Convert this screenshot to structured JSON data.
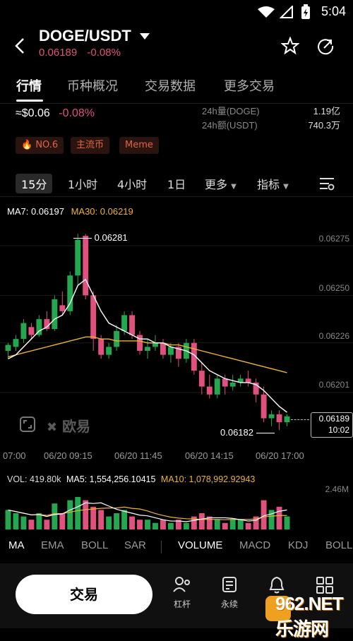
{
  "status_bar": {
    "time": "5:04"
  },
  "header": {
    "pair": "DOGE/USDT",
    "price": "0.06189",
    "change": "-0.08%"
  },
  "tabs": [
    "行情",
    "币种概况",
    "交易数据",
    "更多交易"
  ],
  "summary": {
    "approx_price": "≈$0.06",
    "change": "-0.08%",
    "vol_label": "24h量(DOGE)",
    "vol_value": "1.19亿",
    "amount_label": "24h额(USDT)",
    "amount_value": "740.3万"
  },
  "tags": [
    "NO.6",
    "主流币",
    "Meme"
  ],
  "intervals": [
    "15分",
    "1小时",
    "4小时",
    "1日",
    "更多",
    "指标"
  ],
  "ma": {
    "ma7_label": "MA7: 0.06197",
    "ma30_label": "MA30: 0.06219"
  },
  "price_axis": [
    "0.06275",
    "0.06250",
    "0.06226",
    "0.06201"
  ],
  "high_marker": "0.06281",
  "low_marker": "0.06182",
  "last_price_box": {
    "price": "0.06189",
    "countdown": "10:02"
  },
  "watermark": "欧易",
  "time_axis": [
    "07:00",
    "06/20 09:15",
    "06/20 11:45",
    "06/20 14:15",
    "06/20 17:00"
  ],
  "volume": {
    "vol_label": "VOL: 419.80k",
    "ma5_label": "MA5: 1,554,256.10415",
    "ma10_label": "MA10: 1,078,992.92943",
    "max_label": "2.46M"
  },
  "indicator_tabs": [
    "MA",
    "EMA",
    "BOLL",
    "SAR",
    "VOLUME",
    "MACD",
    "KDJ",
    "BOLL"
  ],
  "bottom_nav": {
    "trade": "交易",
    "items": [
      "杠杆",
      "永续"
    ]
  },
  "overlay_watermark": "962.NET 乐游网",
  "colors": {
    "up": "#25a750",
    "down": "#e0527d",
    "ma7": "#ffffff",
    "ma30": "#f0b330",
    "tag": "#e2643e"
  },
  "chart_data": {
    "type": "candlestick",
    "x_labels": [
      "07:00",
      "06/20 09:15",
      "06/20 11:45",
      "06/20 14:15",
      "06/20 17:00"
    ],
    "ylim": [
      0.0618,
      0.06285
    ],
    "candles": [
      {
        "o": 0.06222,
        "h": 0.06226,
        "l": 0.06218,
        "c": 0.06225
      },
      {
        "o": 0.06224,
        "h": 0.0623,
        "l": 0.06222,
        "c": 0.06228
      },
      {
        "o": 0.06228,
        "h": 0.06238,
        "l": 0.06226,
        "c": 0.06236
      },
      {
        "o": 0.06234,
        "h": 0.06236,
        "l": 0.06228,
        "c": 0.0623
      },
      {
        "o": 0.0623,
        "h": 0.0624,
        "l": 0.06229,
        "c": 0.06238
      },
      {
        "o": 0.06238,
        "h": 0.06242,
        "l": 0.06232,
        "c": 0.06233
      },
      {
        "o": 0.06233,
        "h": 0.0625,
        "l": 0.06232,
        "c": 0.06248
      },
      {
        "o": 0.06245,
        "h": 0.06252,
        "l": 0.0624,
        "c": 0.06242
      },
      {
        "o": 0.06242,
        "h": 0.06262,
        "l": 0.0624,
        "c": 0.0626
      },
      {
        "o": 0.0626,
        "h": 0.06281,
        "l": 0.06255,
        "c": 0.06278
      },
      {
        "o": 0.0628,
        "h": 0.06281,
        "l": 0.06248,
        "c": 0.0625
      },
      {
        "o": 0.0625,
        "h": 0.06252,
        "l": 0.06222,
        "c": 0.06228
      },
      {
        "o": 0.06228,
        "h": 0.0623,
        "l": 0.06218,
        "c": 0.0622
      },
      {
        "o": 0.0622,
        "h": 0.06226,
        "l": 0.06218,
        "c": 0.06224
      },
      {
        "o": 0.06224,
        "h": 0.06235,
        "l": 0.06222,
        "c": 0.06232
      },
      {
        "o": 0.06232,
        "h": 0.06242,
        "l": 0.0623,
        "c": 0.0624
      },
      {
        "o": 0.0624,
        "h": 0.06242,
        "l": 0.06228,
        "c": 0.0623
      },
      {
        "o": 0.0623,
        "h": 0.06232,
        "l": 0.0622,
        "c": 0.06222
      },
      {
        "o": 0.06222,
        "h": 0.06228,
        "l": 0.06218,
        "c": 0.06224
      },
      {
        "o": 0.06224,
        "h": 0.0623,
        "l": 0.06222,
        "c": 0.06226
      },
      {
        "o": 0.06226,
        "h": 0.06228,
        "l": 0.06218,
        "c": 0.0622
      },
      {
        "o": 0.0622,
        "h": 0.06226,
        "l": 0.06216,
        "c": 0.06224
      },
      {
        "o": 0.06224,
        "h": 0.06226,
        "l": 0.06214,
        "c": 0.06218
      },
      {
        "o": 0.06218,
        "h": 0.06228,
        "l": 0.06216,
        "c": 0.06226
      },
      {
        "o": 0.06226,
        "h": 0.06228,
        "l": 0.0621,
        "c": 0.06212
      },
      {
        "o": 0.06212,
        "h": 0.06216,
        "l": 0.062,
        "c": 0.06204
      },
      {
        "o": 0.06204,
        "h": 0.0621,
        "l": 0.06198,
        "c": 0.062
      },
      {
        "o": 0.062,
        "h": 0.0621,
        "l": 0.06198,
        "c": 0.06208
      },
      {
        "o": 0.06208,
        "h": 0.0621,
        "l": 0.062,
        "c": 0.06204
      },
      {
        "o": 0.06204,
        "h": 0.0621,
        "l": 0.06202,
        "c": 0.06206
      },
      {
        "o": 0.06206,
        "h": 0.0621,
        "l": 0.06204,
        "c": 0.06208
      },
      {
        "o": 0.06208,
        "h": 0.06212,
        "l": 0.06204,
        "c": 0.06206
      },
      {
        "o": 0.06206,
        "h": 0.06208,
        "l": 0.06196,
        "c": 0.062
      },
      {
        "o": 0.062,
        "h": 0.06204,
        "l": 0.06186,
        "c": 0.06188
      },
      {
        "o": 0.06188,
        "h": 0.06192,
        "l": 0.06184,
        "c": 0.0619
      },
      {
        "o": 0.0619,
        "h": 0.06192,
        "l": 0.06182,
        "c": 0.06186
      },
      {
        "o": 0.06186,
        "h": 0.0619,
        "l": 0.06184,
        "c": 0.06189
      }
    ],
    "ma7": [
      0.06218,
      0.0622,
      0.06224,
      0.06228,
      0.06232,
      0.06234,
      0.06238,
      0.0624,
      0.06246,
      0.06255,
      0.06258,
      0.0625,
      0.06242,
      0.06236,
      0.06234,
      0.06232,
      0.0623,
      0.06228,
      0.06228,
      0.06226,
      0.06226,
      0.06224,
      0.06223,
      0.06222,
      0.0622,
      0.06216,
      0.06212,
      0.0621,
      0.06208,
      0.06207,
      0.06206,
      0.06206,
      0.06205,
      0.06202,
      0.06198,
      0.06194,
      0.06191
    ],
    "ma30": [
      0.06219,
      0.0622,
      0.06221,
      0.06222,
      0.06223,
      0.06224,
      0.06225,
      0.06226,
      0.06227,
      0.06228,
      0.06229,
      0.06229,
      0.06228,
      0.06228,
      0.06227,
      0.06227,
      0.06227,
      0.06227,
      0.06226,
      0.06226,
      0.06226,
      0.06225,
      0.06225,
      0.06224,
      0.06223,
      0.06222,
      0.06221,
      0.0622,
      0.06219,
      0.06218,
      0.06217,
      0.06216,
      0.06215,
      0.06214,
      0.06213,
      0.06212,
      0.06211
    ],
    "volumes": [
      0.6,
      0.5,
      0.4,
      0.3,
      0.5,
      0.3,
      0.8,
      0.5,
      0.9,
      1.0,
      0.9,
      0.7,
      0.6,
      0.4,
      0.5,
      0.6,
      0.4,
      0.3,
      0.3,
      0.2,
      0.3,
      0.2,
      0.3,
      0.2,
      0.4,
      0.5,
      0.4,
      0.3,
      0.2,
      0.3,
      0.3,
      0.2,
      0.4,
      0.9,
      0.6,
      0.7,
      0.4
    ]
  }
}
